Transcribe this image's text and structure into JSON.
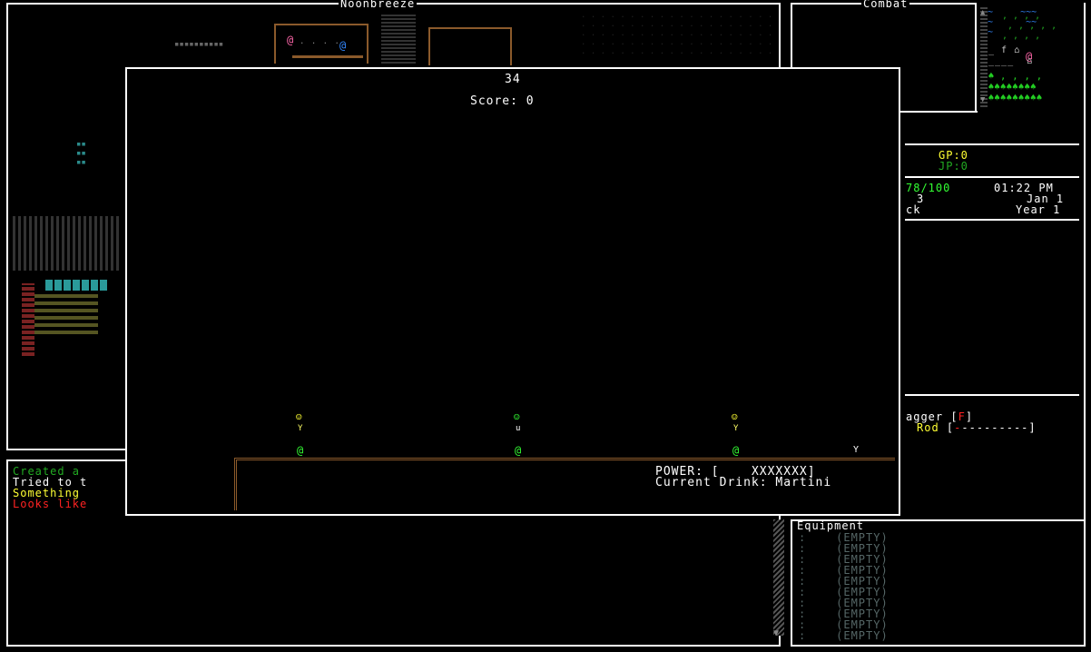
{
  "colors": {
    "border": "#ffffff",
    "background": "#000000",
    "counter_brown": "#8b5a2b",
    "green_text": "#22aa22",
    "bright_green": "#33ff33",
    "yellow": "#ffff33",
    "red": "#ff2222",
    "gray_empty": "#556666",
    "pink_player": "#ff66aa",
    "blue_npc": "#3388ff"
  },
  "map_panel": {
    "title": "Noonbreeze"
  },
  "combat_panel": {
    "title": "Combat"
  },
  "currency": {
    "gp": "GP:0",
    "jp": "JP:0"
  },
  "status": {
    "hp": "78/100",
    "time": "01:22 PM",
    "line2_left": "3",
    "date": "Jan 1",
    "line3_left": "ck",
    "year": "Year 1"
  },
  "weapons": {
    "line1_name": "agger [",
    "line1_key": "F",
    "line1_close": "]",
    "line2_name": "Rod",
    "line2_open": " [",
    "line2_red": "-",
    "line2_dashes": "---------]"
  },
  "message_log": [
    {
      "text": "Created a",
      "color": "#22aa22"
    },
    {
      "text": "Tried to t",
      "color": "#ffffff"
    },
    {
      "text": "Something",
      "color": "#ffff33"
    },
    {
      "text": "Looks like",
      "color": "#ff2222"
    }
  ],
  "equipment": {
    "title": "Equipment",
    "slots": [
      "(EMPTY)",
      "(EMPTY)",
      "(EMPTY)",
      "(EMPTY)",
      "(EMPTY)",
      "(EMPTY)",
      "(EMPTY)",
      "(EMPTY)",
      "(EMPTY)",
      "(EMPTY)"
    ]
  },
  "minigame": {
    "timer": "34",
    "score": "Score: 0",
    "power_label": "POWER: [",
    "power_value": "XXXXXXX]",
    "current_drink": "Current Drink: Martini",
    "customers": [
      {
        "face": "☺",
        "face_color": "#ffff33",
        "drink": "Y",
        "drink_color": "#ffff66",
        "bartender_color": "#33ff33"
      },
      {
        "face": "☺",
        "face_color": "#33ff33",
        "drink": "u",
        "drink_color": "#ffffff",
        "bartender_color": "#33ff33"
      },
      {
        "face": "☺",
        "face_color": "#ffff33",
        "drink": "Y",
        "drink_color": "#ffff66",
        "bartender_color": "#33ff33"
      }
    ],
    "player_drink": "Y",
    "bartender_glyph": "@"
  }
}
